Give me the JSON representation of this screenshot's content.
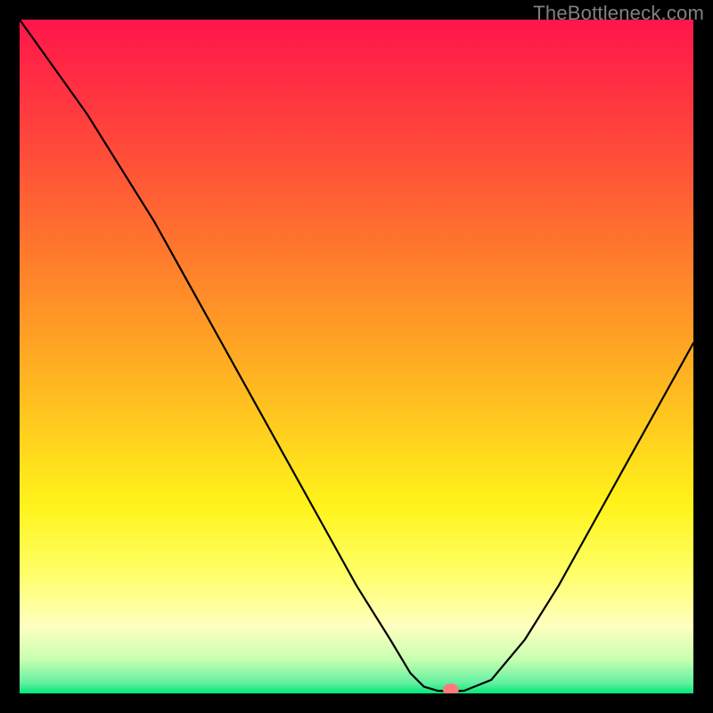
{
  "watermark": "TheBottleneck.com",
  "chart_data": {
    "type": "line",
    "title": "",
    "xlabel": "",
    "ylabel": "",
    "xlim": [
      0,
      100
    ],
    "ylim": [
      0,
      100
    ],
    "x": [
      0,
      5,
      10,
      15,
      20,
      25,
      30,
      35,
      40,
      45,
      50,
      55,
      58,
      60,
      62,
      64,
      66,
      70,
      75,
      80,
      85,
      90,
      95,
      100
    ],
    "values": [
      100,
      93,
      86,
      78,
      70,
      61,
      52,
      43,
      34,
      25,
      16,
      8,
      3,
      1,
      0.4,
      0.3,
      0.4,
      2,
      8,
      16,
      25,
      34,
      43,
      52
    ],
    "background_gradient": {
      "type": "vertical",
      "stops": [
        {
          "pos": 0.0,
          "color": "#ff154b"
        },
        {
          "pos": 0.15,
          "color": "#ff3e3e"
        },
        {
          "pos": 0.35,
          "color": "#ff7a2c"
        },
        {
          "pos": 0.55,
          "color": "#ffba20"
        },
        {
          "pos": 0.72,
          "color": "#fff31a"
        },
        {
          "pos": 0.82,
          "color": "#ffff66"
        },
        {
          "pos": 0.9,
          "color": "#ffffc0"
        },
        {
          "pos": 0.95,
          "color": "#c7ffb0"
        },
        {
          "pos": 0.985,
          "color": "#60f0a0"
        },
        {
          "pos": 1.0,
          "color": "#00e878"
        }
      ]
    },
    "marker": {
      "x": 64,
      "y": 0.6,
      "color": "#ff7a7a"
    },
    "line_color": "#000000",
    "line_width": 2.2
  }
}
